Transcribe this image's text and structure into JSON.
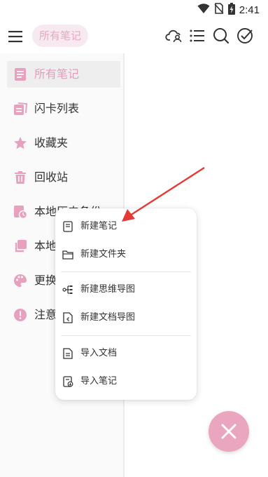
{
  "status_bar": {
    "time": "2:41",
    "icons": [
      "wifi-icon",
      "no-sim-icon",
      "battery-charging-icon"
    ]
  },
  "top_bar": {
    "title": "所有笔记",
    "icons": [
      "menu-icon",
      "cloud-user-icon",
      "list-icon",
      "search-icon",
      "check-circle-icon"
    ]
  },
  "sidebar": {
    "items": [
      {
        "label": "所有笔记",
        "icon": "note-icon",
        "selected": true
      },
      {
        "label": "闪卡列表",
        "icon": "flashcard-icon",
        "selected": false
      },
      {
        "label": "收藏夹",
        "icon": "star-icon",
        "selected": false
      },
      {
        "label": "回收站",
        "icon": "trash-icon",
        "selected": false
      },
      {
        "label": "本地历史备份",
        "icon": "history-icon",
        "selected": false
      },
      {
        "label": "本地",
        "icon": "copy-icon",
        "selected": false
      },
      {
        "label": "更换",
        "icon": "palette-icon",
        "selected": false
      },
      {
        "label": "注意",
        "icon": "alert-icon",
        "selected": false
      }
    ]
  },
  "context_menu": {
    "items": [
      {
        "label": "新建笔记",
        "icon": "note-outline-icon"
      },
      {
        "label": "新建文件夹",
        "icon": "folder-icon"
      },
      {
        "label": "新建思维导图",
        "icon": "mindmap-icon"
      },
      {
        "label": "新建文档导图",
        "icon": "doc-mindmap-icon"
      },
      {
        "label": "导入文档",
        "icon": "import-doc-icon"
      },
      {
        "label": "导入笔记",
        "icon": "import-note-icon"
      }
    ]
  },
  "fab": {
    "icon": "close-icon"
  },
  "colors": {
    "accent_pink": "#eba6bf",
    "selected_text": "#e79bbb",
    "sidebar_icon": "#e9a0be",
    "annotation_red": "#e53935"
  }
}
